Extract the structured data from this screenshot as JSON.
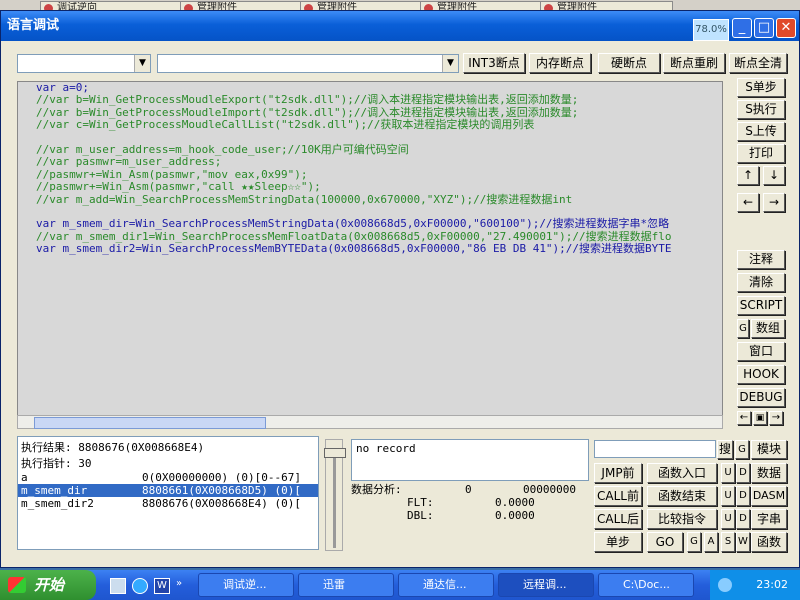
{
  "bg_tabs": [
    "调试逆向",
    "管理附件",
    "管理附件",
    "管理附件",
    "管理附件"
  ],
  "window": {
    "title": "语言调试",
    "cpu_percent": "78.0%",
    "min": "_",
    "max": "□",
    "close": "✕"
  },
  "toolbar": {
    "int3": "INT3断点",
    "mem": "内存断点",
    "hw": "硬断点",
    "reset": "断点重刷",
    "clear_all": "断点全清"
  },
  "code_lines": [
    {
      "t": "var a=0;",
      "c": "#1a1aa6"
    },
    {
      "t": "//var b=Win_GetProcessMoudleExport(\"t2sdk.dll\");//调入本进程指定模块输出表,返回添加数量;",
      "c": "#2a8a2a"
    },
    {
      "t": "//var b=Win_GetProcessMoudleImport(\"t2sdk.dll\");//调入本进程指定模块输出表,返回添加数量;",
      "c": "#2a8a2a"
    },
    {
      "t": "//var c=Win_GetProcessMoudleCallList(\"t2sdk.dll\");//获取本进程指定模块的调用列表",
      "c": "#2a8a2a"
    },
    {
      "t": "",
      "c": "#000"
    },
    {
      "t": "//var m_user_address=m_hook_code_user;//10K用户可编代码空间",
      "c": "#2a8a2a"
    },
    {
      "t": "//var pasmwr=m_user_address;",
      "c": "#2a8a2a"
    },
    {
      "t": "//pasmwr+=Win_Asm(pasmwr,\"mov eax,0x99\");",
      "c": "#2a8a2a"
    },
    {
      "t": "//pasmwr+=Win_Asm(pasmwr,\"call ★★Sleep☆☆\");",
      "c": "#2a8a2a"
    },
    {
      "t": "//var m_add=Win_SearchProcessMemStringData(100000,0x670000,\"XYZ\");//搜索进程数据int",
      "c": "#2a8a2a"
    },
    {
      "t": "",
      "c": "#000"
    },
    {
      "t": "var m_smem_dir=Win_SearchProcessMemStringData(0x008668d5,0xF00000,\"600100\");//搜索进程数据字串*忽略",
      "c": "#1a1aa6"
    },
    {
      "t": "//var m_smem_dir1=Win_SearchProcessMemFloatData(0x008668d5,0xF00000,\"27.490001\");//搜索进程数据flo",
      "c": "#2a8a2a"
    },
    {
      "t": "var m_smem_dir2=Win_SearchProcessMemBYTEData(0x008668d5,0xF00000,\"86 EB DB 41\");//搜索进程数据BYTE",
      "c": "#1a1aa6"
    }
  ],
  "right_buttons": {
    "step": "S单步",
    "exec": "S执行",
    "up": "S上传",
    "print": "打印",
    "arrow_up": "↑",
    "arrow_down": "↓",
    "arrow_left": "←",
    "arrow_right": "→",
    "comment": "注释",
    "clear": "清除",
    "script": "SCRIPT",
    "g": "G",
    "array": "数组",
    "window": "窗口",
    "hook": "HOOK",
    "debug": "DEBUG",
    "nav_left": "←",
    "nav_mid": "▣",
    "nav_right": "→"
  },
  "results": {
    "exec_result": "执行结果:  8808676(0X008668E4)",
    "exec_pointer": "执行指针: 30",
    "rows": [
      {
        "name": "a",
        "value": "0(0X00000000)   (0)[0--67]",
        "selected": false
      },
      {
        "name": "m_smem_dir",
        "value": "8808661(0X008668D5)  (0)[",
        "selected": true
      },
      {
        "name": "m_smem_dir2",
        "value": "8808676(0X008668E4)   (0)[",
        "selected": false
      }
    ]
  },
  "record": "no record",
  "analysis": {
    "label": "数据分析:",
    "v1": "0",
    "v2": "00000000",
    "flt_label": "FLT:",
    "flt": "0.0000",
    "dbl_label": "DBL:",
    "dbl": "0.0000"
  },
  "bottom_buttons": {
    "search": "搜",
    "g": "G",
    "module": "模块",
    "jmp_before": "JMP前",
    "func_entry": "函数入口",
    "u": "U",
    "d": "D",
    "data": "数据",
    "call_before": "CALL前",
    "func_end": "函数结束",
    "dasm": "DASM",
    "call_after": "CALL后",
    "compare": "比较指令",
    "byte": "字串",
    "single_step": "单步",
    "go": "GO",
    "gg": "G",
    "a": "A",
    "s": "S",
    "w": "W",
    "func": "函数"
  },
  "taskbar": {
    "start": "开始",
    "tasks": [
      "调试逆...",
      "迅雷",
      "通达信...",
      "远程调...",
      "C:\\Doc..."
    ],
    "clock": "23:02"
  }
}
